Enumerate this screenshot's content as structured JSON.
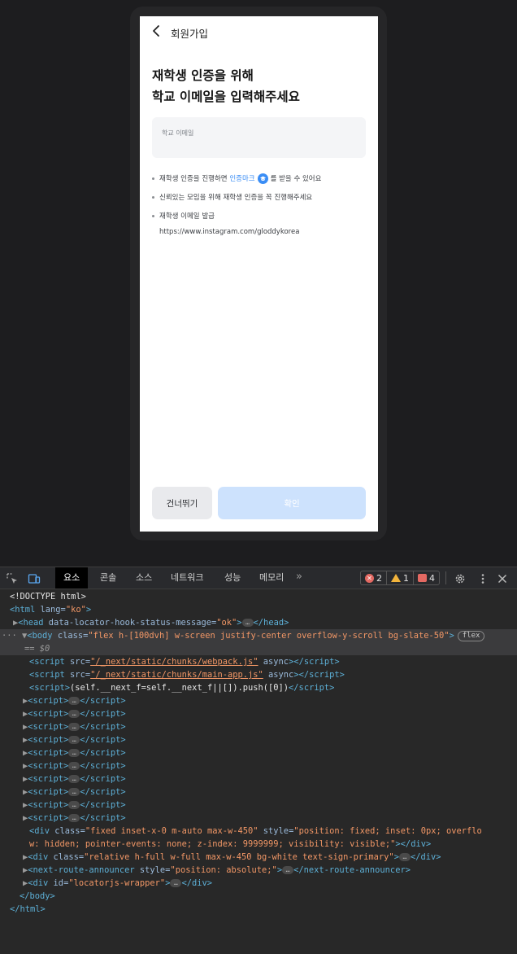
{
  "page": {
    "header_title": "회원가입",
    "headline_line1": "재학생 인증을 위해",
    "headline_line2": "학교 이메일을 입력해주세요",
    "email_label": "학교 이메일",
    "email_value": "",
    "bullets": {
      "b1_pre": "재학생 인증을 진행하면 ",
      "b1_blue": "인증마크",
      "b1_post": " 를 받을 수 있어요",
      "b2": "신뢰있는 모임을 위해 재학생 인증을 꼭 진행해주세요",
      "b3": "재학생 이메일 발급"
    },
    "link": "https://www.instagram.com/gloddykorea",
    "skip_label": "건너뛰기",
    "confirm_label": "확인",
    "colors": {
      "accent": "#3a8df5",
      "confirm_disabled": "#cde2fd"
    }
  },
  "devtools": {
    "tabs": [
      "요소",
      "콘솔",
      "소스",
      "네트워크",
      "성능",
      "메모리"
    ],
    "errors": "2",
    "warnings": "1",
    "issues": "4",
    "lines": {
      "l0": "<!DOCTYPE html>",
      "l1_tag": "<html",
      "l1_attr": " lang=",
      "l1_val": "\"ko\"",
      "l1_end": ">",
      "l2_tag": "<head",
      "l2_attr": " data-locator-hook-status-message=",
      "l2_val": "\"ok\"",
      "l2_close": "</head>",
      "l3_tag": "<body",
      "l3_attr": " class=",
      "l3_val": "\"flex h-[100dvh] w-screen justify-center overflow-y-scroll bg-slate-50\"",
      "l3_badge": "flex",
      "l3b": "== $0",
      "s1_src": "\"/_next/static/chunks/webpack.js\"",
      "s2_src": "\"/_next/static/chunks/main-app.js\"",
      "async": " async",
      "s3_text": "(self.__next_f=self.__next_f||[]).push([0])",
      "div1_class": "\"fixed inset-x-0 m-auto max-w-450\"",
      "div1_style": "\"position: fixed; inset: 0px; overflo",
      "div1_style2": "w: hidden; pointer-events: none; z-index: 9999999; visibility: visible;\"",
      "div2_class": "\"relative h-full w-full max-w-450 bg-white text-sign-primary\"",
      "nra_style": "\"position: absolute;\"",
      "locator_id": "\"locatorjs-wrapper\""
    }
  }
}
